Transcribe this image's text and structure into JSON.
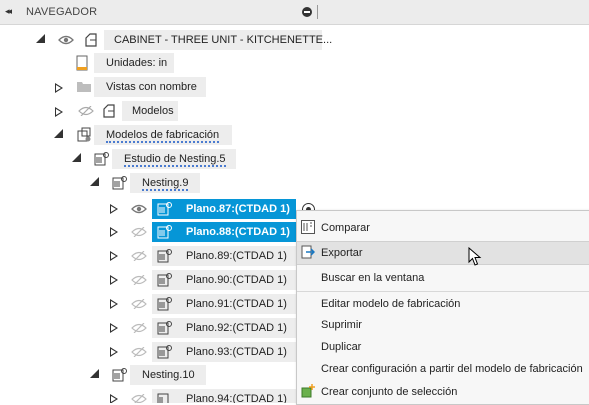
{
  "panel": {
    "collapse_glyph": "◂◂",
    "title": "NAVEGADOR"
  },
  "tree": {
    "root": "CABINET - THREE UNIT - KITCHENETTE...",
    "units": "Unidades: in",
    "named_views": "Vistas con nombre",
    "models": "Modelos",
    "fab_models": "Modelos de fabricación",
    "nesting_study": "Estudio de Nesting.5",
    "nesting9": "Nesting.9",
    "planes": [
      "Plano.87:(CTDAD 1)",
      "Plano.88:(CTDAD 1)",
      "Plano.89:(CTDAD 1)",
      "Plano.90:(CTDAD 1)",
      "Plano.91:(CTDAD 1)",
      "Plano.92:(CTDAD 1)",
      "Plano.93:(CTDAD 1)"
    ],
    "nesting10": "Nesting.10",
    "plane94": "Plano.94:(CTDAD 1)"
  },
  "context_menu": {
    "items": [
      "Comparar",
      "Exportar",
      "Buscar en la ventana",
      "Editar modelo de fabricación",
      "Suprimir",
      "Duplicar",
      "Crear configuración a partir del modelo de fabricación",
      "Crear conjunto de selección"
    ],
    "highlighted": "Exportar"
  },
  "colors": {
    "selection": "#0696d7",
    "highlight": "#e2e2e2",
    "header": "#ececec"
  }
}
